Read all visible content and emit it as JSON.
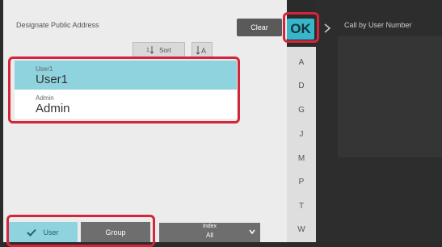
{
  "header": {
    "title": "Designate Public Address",
    "clear_label": "Clear",
    "ok_label": "OK",
    "right_title": "Call by User Number"
  },
  "toolbar": {
    "sort_label": "Sort",
    "sort_icon": "sort-icon",
    "az_icon": "az-sort-icon"
  },
  "list": [
    {
      "small": "User1",
      "big": "User1",
      "selected": true
    },
    {
      "small": "Admin",
      "big": "Admin",
      "selected": false
    }
  ],
  "tabs": {
    "user_label": "User",
    "group_label": "Group"
  },
  "index_select": {
    "label": "Index",
    "value": "All"
  },
  "index_letters": [
    "A",
    "D",
    "G",
    "J",
    "M",
    "P",
    "T",
    "W"
  ],
  "colors": {
    "accent": "#36b6c8",
    "selected_row": "#8fd3de",
    "highlight": "#d3263a"
  }
}
